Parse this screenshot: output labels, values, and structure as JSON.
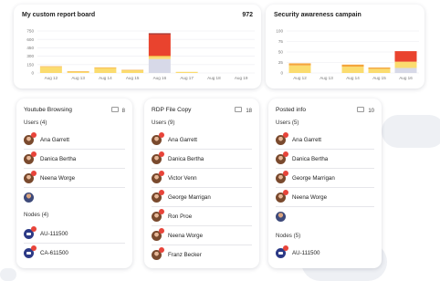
{
  "colors": {
    "orange": "#f4a53b",
    "yellow": "#fbdc6f",
    "red": "#e9432e",
    "dark_red": "#9c1e17",
    "lavender": "#d7d9e8",
    "avatar_badge": "#e8443a",
    "node_blue": "#2c3a86"
  },
  "board_chart": {
    "title": "My custom report board",
    "total": "972",
    "chart_data": {
      "type": "bar",
      "stacked": true,
      "categories": [
        "Aug 12",
        "Aug 13",
        "Aug 14",
        "Aug 15",
        "Aug 16",
        "Aug 17",
        "Aug 18",
        "Aug 19"
      ],
      "y_ticks": [
        "0",
        "150",
        "300",
        "450",
        "600",
        "750"
      ],
      "ylim": [
        0,
        750
      ],
      "grid": true,
      "series": [
        {
          "color_key": "lavender",
          "values": [
            0,
            0,
            0,
            0,
            250,
            0,
            0,
            0
          ]
        },
        {
          "color_key": "yellow",
          "values": [
            110,
            25,
            90,
            50,
            40,
            20,
            0,
            0
          ]
        },
        {
          "color_key": "orange",
          "values": [
            10,
            5,
            10,
            5,
            20,
            0,
            0,
            0
          ]
        },
        {
          "color_key": "red",
          "values": [
            0,
            0,
            0,
            0,
            380,
            0,
            0,
            0
          ]
        },
        {
          "color_key": "dark_red",
          "values": [
            0,
            0,
            0,
            0,
            20,
            0,
            0,
            0
          ]
        }
      ]
    }
  },
  "security_chart": {
    "title": "Security awareness campain",
    "chart_data": {
      "type": "bar",
      "stacked": true,
      "categories": [
        "Aug 12",
        "Aug 13",
        "Aug 14",
        "Aug 15",
        "Aug 16"
      ],
      "y_ticks": [
        "0",
        "25",
        "50",
        "75",
        "100"
      ],
      "ylim": [
        0,
        100
      ],
      "grid": true,
      "series": [
        {
          "color_key": "lavender",
          "values": [
            0,
            0,
            0,
            0,
            12
          ]
        },
        {
          "color_key": "yellow",
          "values": [
            18,
            0,
            15,
            10,
            15
          ]
        },
        {
          "color_key": "orange",
          "values": [
            5,
            0,
            5,
            3,
            0
          ]
        },
        {
          "color_key": "red",
          "values": [
            0,
            0,
            0,
            0,
            25
          ]
        }
      ]
    }
  },
  "youtube": {
    "title": "Youtube Browsing",
    "count": "8",
    "users_label": "Users (4)",
    "users": [
      "Ana Garrett",
      "Danica Bertha",
      "Neena Worge",
      ""
    ],
    "nodes_label": "Nodes (4)",
    "nodes": [
      "AU-111500",
      "CA-611500"
    ]
  },
  "rdp": {
    "title": "RDP File Copy",
    "count": "18",
    "users_label": "Users (9)",
    "users": [
      "Ana Garrett",
      "Danica Bertha",
      "Victor Venn",
      "George Marrigan",
      "Ron Proe",
      "Neena Worge",
      "Franz Becker"
    ]
  },
  "posted": {
    "title": "Posted info",
    "count": "10",
    "users_label": "Users (5)",
    "users": [
      "Ana Garrett",
      "Danica Bertha",
      "George Marrigan",
      "Neena Worge",
      ""
    ],
    "nodes_label": "Nodes (5)",
    "nodes": [
      "AU-111500"
    ]
  }
}
